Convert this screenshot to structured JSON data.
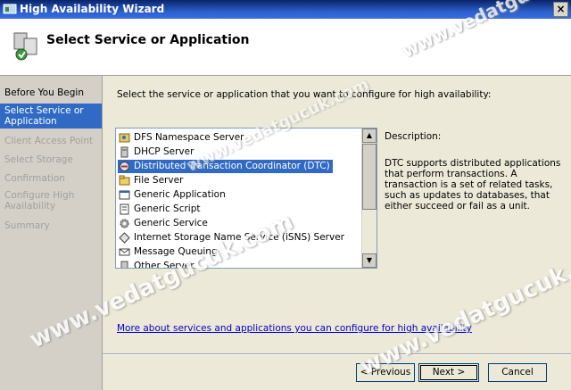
{
  "window": {
    "title": "High Availability Wizard",
    "close_label": "×"
  },
  "header": {
    "title": "Select Service or Application"
  },
  "steps": [
    {
      "label": "Before You Begin",
      "state": "done"
    },
    {
      "label": "Select Service or Application",
      "state": "active"
    },
    {
      "label": "Client Access Point",
      "state": "pending"
    },
    {
      "label": "Select Storage",
      "state": "pending"
    },
    {
      "label": "Confirmation",
      "state": "pending"
    },
    {
      "label": "Configure High Availability",
      "state": "pending"
    },
    {
      "label": "Summary",
      "state": "pending"
    }
  ],
  "main": {
    "instruction": "Select the service or application that you want to configure for high availability:",
    "services": [
      {
        "label": "DFS Namespace Server",
        "icon": "dfs-icon"
      },
      {
        "label": "DHCP Server",
        "icon": "server-icon"
      },
      {
        "label": "Distributed Transaction Coordinator (DTC)",
        "icon": "dtc-icon",
        "selected": true
      },
      {
        "label": "File Server",
        "icon": "file-server-icon"
      },
      {
        "label": "Generic Application",
        "icon": "application-icon"
      },
      {
        "label": "Generic Script",
        "icon": "script-icon"
      },
      {
        "label": "Generic Service",
        "icon": "gear-icon"
      },
      {
        "label": "Internet Storage Name Service (iSNS) Server",
        "icon": "isns-icon"
      },
      {
        "label": "Message Queuing",
        "icon": "message-queue-icon"
      },
      {
        "label": "Other Server",
        "icon": "server-icon"
      }
    ],
    "description_label": "Description:",
    "description_text": "DTC supports distributed applications that perform transactions. A transaction is a set of related tasks, such as updates to databases, that either succeed or fail as a unit.",
    "more_link": "More about services and applications you can configure for high availability"
  },
  "buttons": {
    "previous": "< Previous",
    "next": "Next >",
    "cancel": "Cancel"
  },
  "watermark": "www.vedatgucuk.com",
  "colors": {
    "selection": "#316ac5",
    "link": "#0000cc"
  }
}
